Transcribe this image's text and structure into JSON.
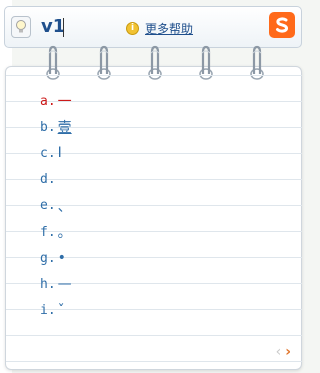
{
  "input": {
    "text": "v1"
  },
  "help": {
    "label": "更多帮助",
    "icon": "info-icon"
  },
  "logo": {
    "icon": "sogou-s-logo",
    "color": "#ff6a1a"
  },
  "candidates": [
    {
      "label": "a.",
      "value": "一"
    },
    {
      "label": "b.",
      "value": "壹"
    },
    {
      "label": "c.",
      "value": "I"
    },
    {
      "label": "d.",
      "value": ""
    },
    {
      "label": "e.",
      "value": "、"
    },
    {
      "label": "f.",
      "value": "。"
    },
    {
      "label": "g.",
      "value": "•"
    },
    {
      "label": "h.",
      "value": "—"
    },
    {
      "label": "i.",
      "value": "ˇ"
    }
  ],
  "pager": {
    "prev": "‹",
    "next": "›"
  },
  "colors": {
    "accent": "#2f6ea8",
    "active": "#cc1a1a",
    "next_arrow": "#e0752b"
  }
}
